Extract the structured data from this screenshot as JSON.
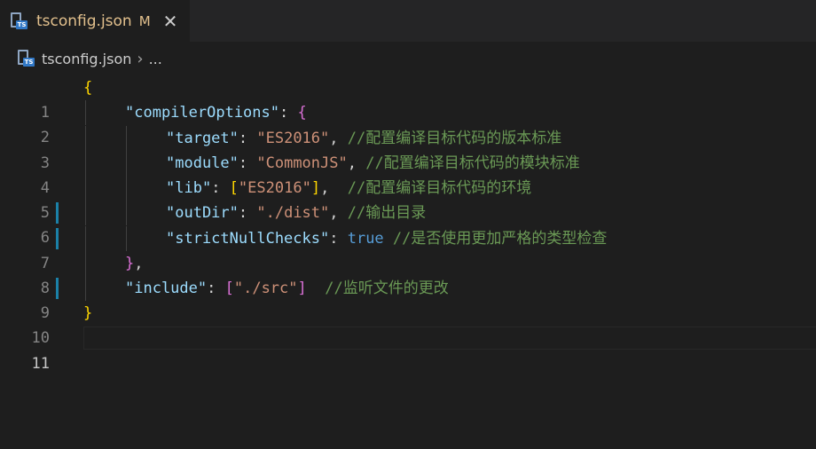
{
  "tab": {
    "icon": "typescript-config-file-icon",
    "icon_badge": "TS",
    "title": "tsconfig.json",
    "status": "M",
    "close_label": "✕"
  },
  "breadcrumb": {
    "file": "tsconfig.json",
    "separator": "›",
    "more": "..."
  },
  "editor": {
    "lines": [
      {
        "n": "1",
        "t": "{"
      },
      {
        "n": "2",
        "t": "\"compilerOptions\": {"
      },
      {
        "n": "3",
        "t": "\"target\": \"ES2016\", //配置编译目标代码的版本标准"
      },
      {
        "n": "4",
        "t": "\"module\": \"CommonJS\", //配置编译目标代码的模块标准"
      },
      {
        "n": "5",
        "t": "\"lib\": [\"ES2016\"],  //配置编译目标代码的环境"
      },
      {
        "n": "6",
        "t": "\"outDir\": \"./dist\", //输出目录"
      },
      {
        "n": "7",
        "t": "\"strictNullChecks\": true //是否使用更加严格的类型检查"
      },
      {
        "n": "8",
        "t": "},"
      },
      {
        "n": "9",
        "t": "\"include\": [\"./src\"]  //监听文件的更改"
      },
      {
        "n": "10",
        "t": "}"
      },
      {
        "n": "11",
        "t": ""
      }
    ]
  },
  "colors": {
    "background": "#1e1e1e",
    "property": "#9cdcfe",
    "string": "#ce9178",
    "comment": "#6a9955",
    "keyword": "#569cd6",
    "modified_tab": "#e2c08d",
    "gutter_modified": "#1b81a8"
  }
}
